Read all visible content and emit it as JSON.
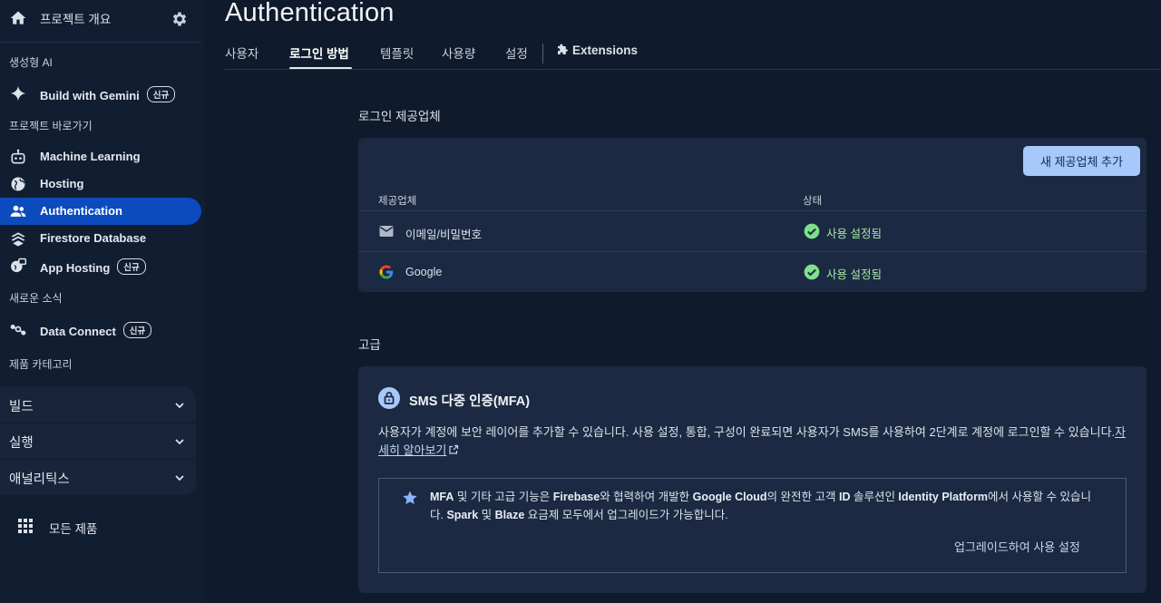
{
  "sidebar": {
    "project_overview": "프로젝트 개요",
    "sections": {
      "gen_ai": "생성형 AI",
      "shortcuts": "프로젝트 바로가기",
      "news": "새로운 소식",
      "categories": "제품 카테고리"
    },
    "items": {
      "build_with_gemini": "Build with Gemini",
      "machine_learning": "Machine Learning",
      "hosting": "Hosting",
      "authentication": "Authentication",
      "firestore": "Firestore Database",
      "app_hosting": "App Hosting",
      "data_connect": "Data Connect"
    },
    "new_badge": "신규",
    "categories": [
      "빌드",
      "실행",
      "애널리틱스"
    ],
    "all_products": "모든 제품"
  },
  "header": {
    "title": "Authentication",
    "tabs": {
      "users": "사용자",
      "sign_in": "로그인 방법",
      "templates": "템플릿",
      "usage": "사용량",
      "settings": "설정",
      "extensions": "Extensions"
    }
  },
  "providers": {
    "heading": "로그인 제공업체",
    "add_button": "새 제공업체 추가",
    "col_provider": "제공업체",
    "col_status": "상태",
    "rows": [
      {
        "name": "이메일/비밀번호",
        "status": "사용 설정됨"
      },
      {
        "name": "Google",
        "status": "사용 설정됨"
      }
    ]
  },
  "advanced": {
    "heading": "고급",
    "mfa_title": "SMS 다중 인증(MFA)",
    "mfa_desc": "사용자가 계정에 보안 레이어를 추가할 수 있습니다. 사용 설정, 통합, 구성이 완료되면 사용자가 SMS를 사용하여 2단계로 계정에 로그인할 수 있습니다.",
    "learn_more": "자세히 알아보기",
    "upgrade": {
      "t1": "MFA",
      "t2": " 및 기타 고급 기능은 ",
      "t3": "Firebase",
      "t4": "와 협력하여 개발한 ",
      "t5": "Google Cloud",
      "t6": "의 완전한 고객 ",
      "t7": "ID",
      "t8": " 솔루션인 ",
      "t9": "Identity Platform",
      "t10": "에서 사용할 수 있습니다. ",
      "t11": "Spark",
      "t12": " 및 ",
      "t13": "Blaze",
      "t14": " 요금제 모두에서 업그레이드가 가능합니다.",
      "link": "업그레이드하여 사용 설정"
    }
  },
  "colors": {
    "accent": "#0b4bbd",
    "button": "#a8c7fa",
    "success": "#7ee08a",
    "background": "#0f1a2c"
  }
}
